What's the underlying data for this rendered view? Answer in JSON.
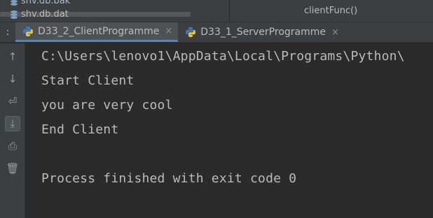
{
  "project_tree": {
    "files": [
      {
        "name": "shv.db.bak",
        "icon": "database-file-icon"
      },
      {
        "name": "shv.db.dat",
        "icon": "database-file-icon"
      }
    ]
  },
  "breadcrumb": {
    "text": "clientFunc()"
  },
  "tab_bar": {
    "lead_icon": "tab-list-icon",
    "lead_glyph": ":",
    "tabs": [
      {
        "label": "D33_2_ClientProgramme",
        "icon": "python-file-icon",
        "close": "×",
        "active": true
      },
      {
        "label": "D33_1_ServerProgramme",
        "icon": "python-file-icon",
        "close": "×",
        "active": false
      }
    ]
  },
  "toolbar": {
    "buttons": [
      {
        "name": "scroll-up-icon",
        "glyph": "↑"
      },
      {
        "name": "scroll-down-icon",
        "glyph": "↓"
      },
      {
        "name": "soft-wrap-icon",
        "glyph": "⏎"
      },
      {
        "name": "scroll-to-end-icon",
        "glyph": "⤓",
        "active": true
      },
      {
        "name": "print-icon",
        "glyph": "⎙"
      },
      {
        "name": "trash-icon",
        "glyph": "🗑"
      }
    ]
  },
  "console": {
    "lines": [
      "C:\\Users\\lenovo1\\AppData\\Local\\Programs\\Python\\",
      "Start Client",
      "you are very cool",
      "End Client",
      "Process finished with exit code 0"
    ]
  },
  "colors": {
    "background": "#2b2b2b",
    "panel": "#3c3f41",
    "text": "#bbbbbb",
    "accent": "#4a88c7"
  }
}
